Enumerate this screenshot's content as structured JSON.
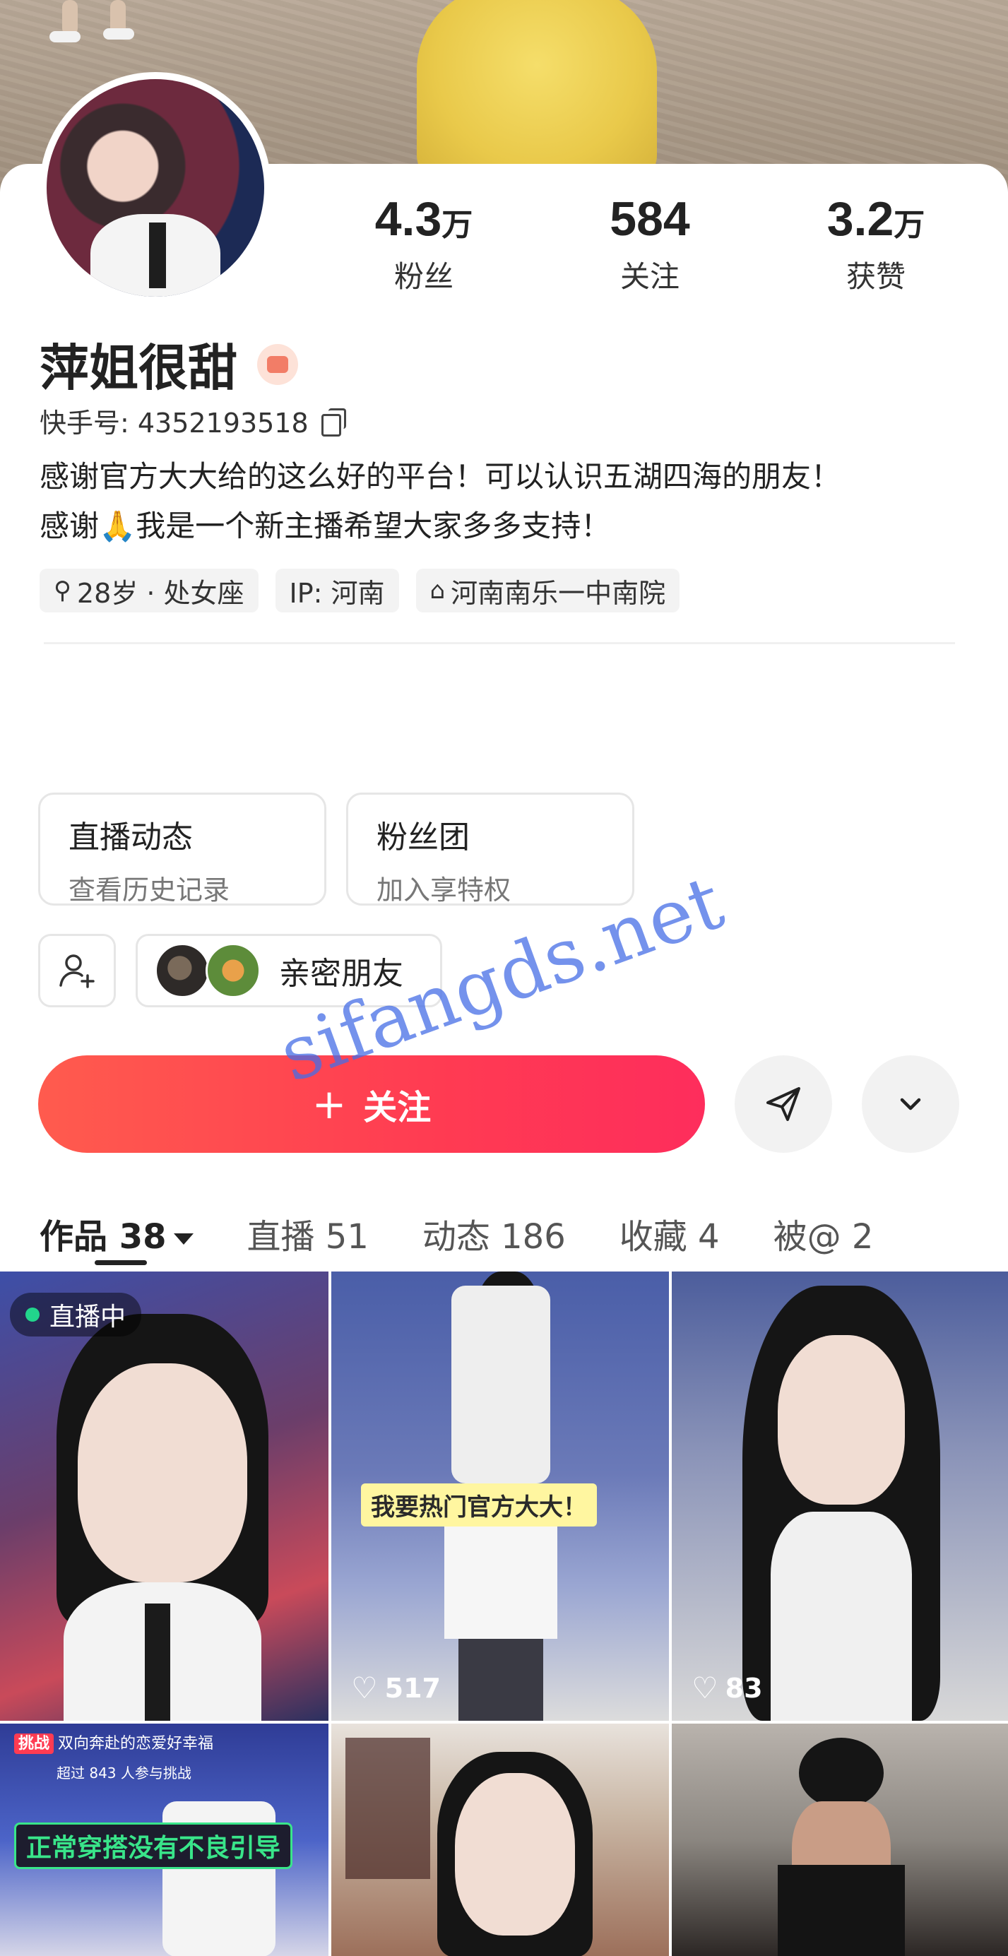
{
  "profile": {
    "name": "萍姐很甜",
    "kuaishou_id": "快手号: 4352193518",
    "bio_line1": "感谢官方大大给的这么好的平台！可以认识五湖四海的朋友！",
    "bio_line2": "感谢🙏我是一个新主播希望大家多多支持！"
  },
  "stats": [
    {
      "num": "4.3",
      "unit": "万",
      "label": "粉丝"
    },
    {
      "num": "584",
      "unit": "",
      "label": "关注"
    },
    {
      "num": "3.2",
      "unit": "万",
      "label": "获赞"
    }
  ],
  "tags": [
    {
      "icon": "search-icon",
      "text": "28岁 · 处女座"
    },
    {
      "icon": "",
      "text": "IP: 河南"
    },
    {
      "icon": "graduation-cap-icon",
      "text": "河南南乐一中南院"
    }
  ],
  "entries": [
    {
      "title": "直播动态",
      "subtitle": "查看历史记录"
    },
    {
      "title": "粉丝团",
      "subtitle": "加入享特权"
    }
  ],
  "friends": {
    "label": "亲密朋友"
  },
  "actions": {
    "follow_label": "关注",
    "follow_icon": "+",
    "share_icon": "send-icon",
    "more_icon": "chevron-down-icon"
  },
  "tabs": [
    {
      "label": "作品 38",
      "active": true
    },
    {
      "label": "直播 51",
      "active": false
    },
    {
      "label": "动态 186",
      "active": false
    },
    {
      "label": "收藏 4",
      "active": false
    },
    {
      "label": "被@ 2",
      "active": false
    }
  ],
  "grid": {
    "live_label": "直播中",
    "items": [
      {
        "likes": ""
      },
      {
        "likes": "517",
        "caption": "我要热门官方大大！"
      },
      {
        "likes": "83"
      },
      {
        "likes": "",
        "challenge_tag": "挑战",
        "challenge_text": "双向奔赴的恋爱好幸福",
        "challenge_sub": "超过 843 人参与挑战",
        "caption": "正常穿搭没有不良引导"
      },
      {
        "likes": ""
      },
      {
        "likes": ""
      }
    ]
  },
  "watermark": "sifangds.net",
  "colors": {
    "accent": "#fe2d5c",
    "live_dot": "#22d58c"
  }
}
